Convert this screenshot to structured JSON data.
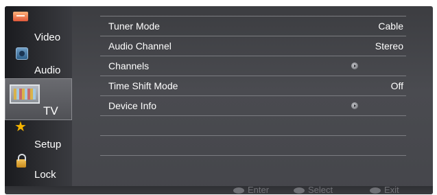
{
  "sidebar": {
    "items": [
      {
        "label": "Video",
        "icon": "video-icon"
      },
      {
        "label": "Audio",
        "icon": "audio-icon"
      },
      {
        "label": "TV",
        "icon": "tv-icon",
        "selected": true
      },
      {
        "label": "Setup",
        "icon": "star-icon"
      },
      {
        "label": "Lock",
        "icon": "lock-icon"
      }
    ]
  },
  "menu": {
    "rows": [
      {
        "label": "Tuner Mode",
        "value": "Cable"
      },
      {
        "label": "Audio Channel",
        "value": "Stereo"
      },
      {
        "label": "Channels",
        "value": "",
        "icon": "submenu-arrow-icon"
      },
      {
        "label": "Time Shift Mode",
        "value": "Off"
      },
      {
        "label": "Device Info",
        "value": "",
        "icon": "submenu-arrow-icon"
      }
    ]
  },
  "footer": {
    "enter_label": "Enter",
    "select_label": "Select",
    "exit_label": "Exit"
  },
  "colors": {
    "panel": "#45464b",
    "sidebar": "#2c2d31",
    "text": "#ffffff",
    "hint": "#6f7075",
    "setup_star": "#f5b400"
  }
}
